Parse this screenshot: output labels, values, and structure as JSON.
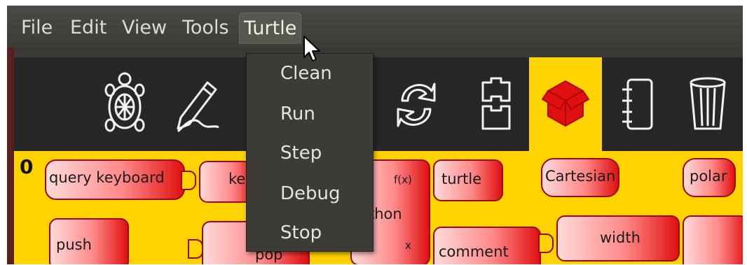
{
  "menubar": {
    "items": [
      {
        "label": "File"
      },
      {
        "label": "Edit"
      },
      {
        "label": "View"
      },
      {
        "label": "Tools"
      },
      {
        "label": "Turtle",
        "active": true
      }
    ]
  },
  "turtle_menu": {
    "items": [
      {
        "label": "Clean"
      },
      {
        "label": "Run"
      },
      {
        "label": "Step"
      },
      {
        "label": "Debug"
      },
      {
        "label": "Stop"
      }
    ]
  },
  "toolbar": {
    "icons": [
      "turtle-icon",
      "pen-icon",
      "sensors-icon",
      "flow-icon",
      "blocks-palette-icon",
      "notebook-icon",
      "trash-icon"
    ],
    "highlight_color": "#ffd400"
  },
  "canvas": {
    "background": "#ffd200",
    "zero_label": "0",
    "blocks": {
      "query_keyboard": "query keyboard",
      "keyboard_partial": "ke",
      "python_fx": "f(x)",
      "python_partial": "thon",
      "python_x": "x",
      "turtle": "turtle",
      "cartesian": "Cartesian",
      "polar": "polar",
      "push": "push",
      "pop_partial": "pop",
      "comment": "comment",
      "width": "width"
    }
  }
}
